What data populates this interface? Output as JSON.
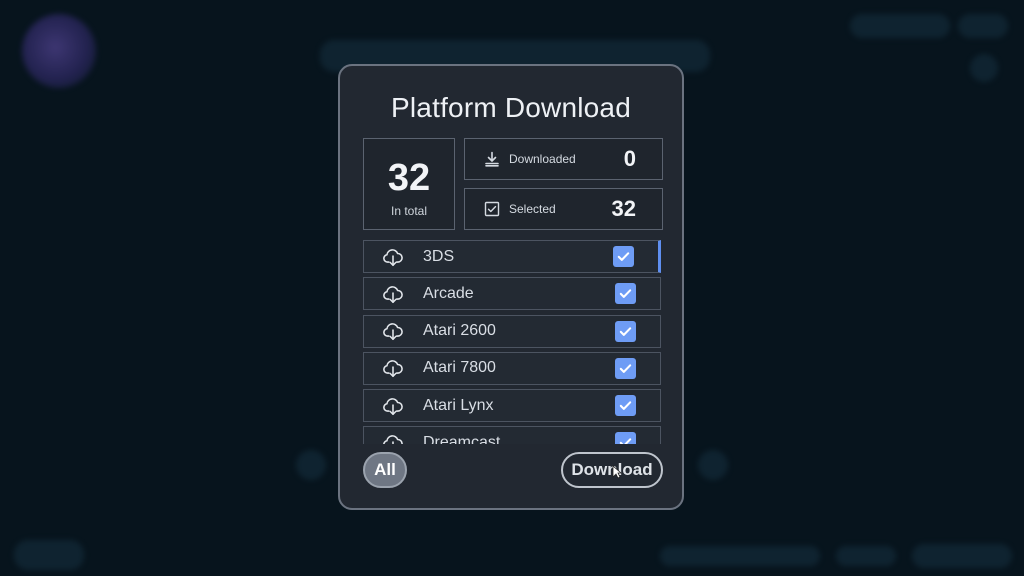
{
  "dialog": {
    "title": "Platform Download",
    "total": {
      "value": "32",
      "label": "In total"
    },
    "downloaded": {
      "label": "Downloaded",
      "value": "0",
      "icon": "download-icon"
    },
    "selected": {
      "label": "Selected",
      "value": "32",
      "icon": "checkbox-icon"
    },
    "platforms": [
      {
        "label": "3DS",
        "checked": true
      },
      {
        "label": "Arcade",
        "checked": true
      },
      {
        "label": "Atari 2600",
        "checked": true
      },
      {
        "label": "Atari 7800",
        "checked": true
      },
      {
        "label": "Atari Lynx",
        "checked": true
      },
      {
        "label": "Dreamcast",
        "checked": true
      }
    ],
    "all_button": "All",
    "download_button": "Download"
  },
  "colors": {
    "accent": "#6e9cf5",
    "panel": "#222831",
    "background": "#07141d"
  }
}
